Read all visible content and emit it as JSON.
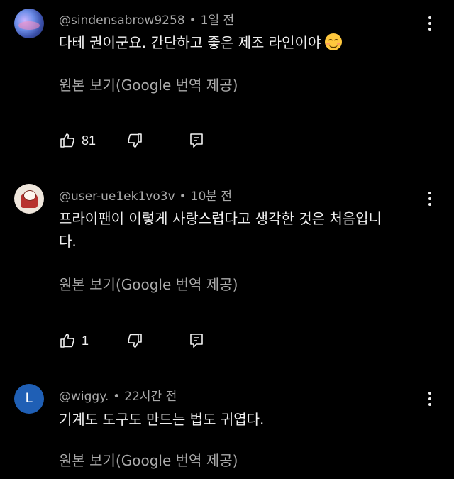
{
  "comments": [
    {
      "author": "@sindensabrow9258",
      "time": "1일 전",
      "text": "다테 권이군요. 간단하고 좋은 제조 라인이야",
      "emoji": "smiling-face-emoji",
      "translate_label": "원본 보기(Google 번역 제공)",
      "likes": "81"
    },
    {
      "author": "@user-ue1ek1vo3v",
      "time": "10분 전",
      "text_line1": "프라이팬이 이렇게 사랑스럽다고 생각한 것은 처음입니",
      "text_line2": "다.",
      "translate_label": "원본 보기(Google 번역 제공)",
      "likes": "1"
    },
    {
      "author": "@wiggy.",
      "time": "22시간 전",
      "avatar_letter": "L",
      "text": "기계도 도구도 만드는 법도 귀엽다.",
      "translate_label": "원본 보기(Google 번역 제공)"
    }
  ],
  "separator": "•",
  "icons": {
    "like": "thumbs-up-icon",
    "dislike": "thumbs-down-icon",
    "reply": "reply-icon",
    "menu": "more-vert-icon"
  },
  "colors": {
    "background": "#000000",
    "text": "#f1f1f1",
    "secondary": "#aaaaaa",
    "avatar_l": "#1f5fb5"
  }
}
